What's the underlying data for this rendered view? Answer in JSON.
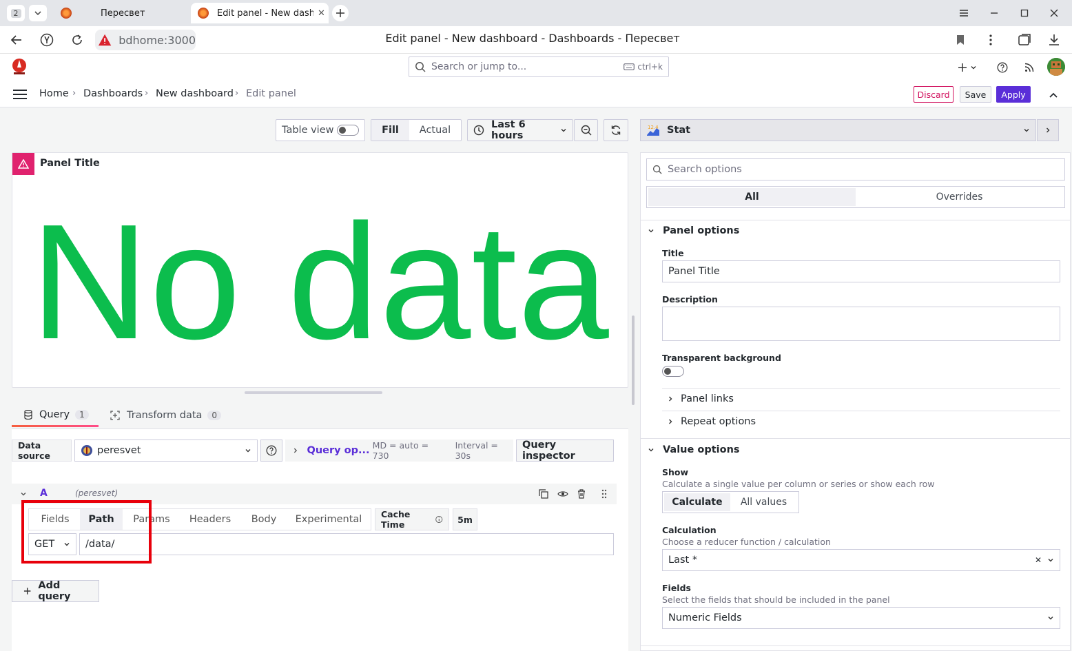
{
  "browser": {
    "tab_count": "2",
    "tabs": [
      {
        "title": "Пересвет"
      },
      {
        "title": "Edit panel - New dashboard"
      }
    ],
    "url": "bdhome:3000",
    "page_title": "Edit panel - New dashboard - Dashboards - Пересвет"
  },
  "grafana": {
    "search_placeholder": "Search or jump to...",
    "search_shortcut": "ctrl+k",
    "breadcrumbs": [
      "Home",
      "Dashboards",
      "New dashboard",
      "Edit panel"
    ],
    "actions": {
      "discard": "Discard",
      "save": "Save",
      "apply": "Apply"
    }
  },
  "toolbar": {
    "table_view": "Table view",
    "fill": "Fill",
    "actual": "Actual",
    "time_range": "Last 6 hours"
  },
  "panel": {
    "title": "Panel Title",
    "no_data": "No data"
  },
  "tabs": {
    "query": {
      "label": "Query",
      "count": "1"
    },
    "transform": {
      "label": "Transform data",
      "count": "0"
    }
  },
  "query": {
    "data_source_label": "Data source",
    "data_source": "peresvet",
    "query_options": "Query op...",
    "md": "MD = auto = 730",
    "interval": "Interval = 30s",
    "inspector": "Query inspector",
    "row": {
      "ref": "A",
      "source": "(peresvet)"
    },
    "subtabs": [
      "Fields",
      "Path",
      "Params",
      "Headers",
      "Body",
      "Experimental"
    ],
    "active_subtab": "Path",
    "cache_time_label": "Cache Time",
    "cache_time_value": "5m",
    "method": "GET",
    "path": "/data/",
    "add_query": "Add query"
  },
  "options": {
    "visualization": "Stat",
    "search_placeholder": "Search options",
    "tab_all": "All",
    "tab_overrides": "Overrides",
    "panel_options": {
      "title": "Panel options",
      "title_label": "Title",
      "title_value": "Panel Title",
      "description_label": "Description",
      "transparent_label": "Transparent background",
      "panel_links": "Panel links",
      "repeat_options": "Repeat options"
    },
    "value_options": {
      "title": "Value options",
      "show_label": "Show",
      "show_desc": "Calculate a single value per column or series or show each row",
      "show_calculate": "Calculate",
      "show_all": "All values",
      "calc_label": "Calculation",
      "calc_desc": "Choose a reducer function / calculation",
      "calc_value": "Last *",
      "fields_label": "Fields",
      "fields_desc": "Select the fields that should be included in the panel",
      "fields_value": "Numeric Fields"
    }
  },
  "colors": {
    "no_data": "#0cbd4d",
    "error": "#e0226e",
    "primary": "#5a2ed8",
    "highlight": "#e8000b"
  }
}
